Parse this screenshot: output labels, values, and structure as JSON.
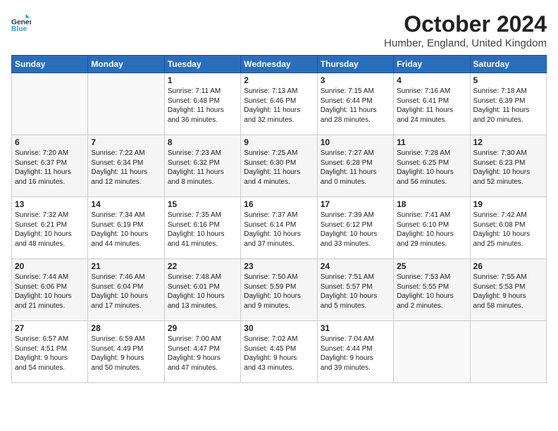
{
  "header": {
    "logo_line1": "General",
    "logo_line2": "Blue",
    "month": "October 2024",
    "location": "Humber, England, United Kingdom"
  },
  "days_of_week": [
    "Sunday",
    "Monday",
    "Tuesday",
    "Wednesday",
    "Thursday",
    "Friday",
    "Saturday"
  ],
  "weeks": [
    [
      {
        "day": "",
        "content": ""
      },
      {
        "day": "",
        "content": ""
      },
      {
        "day": "1",
        "content": "Sunrise: 7:11 AM\nSunset: 6:48 PM\nDaylight: 11 hours\nand 36 minutes."
      },
      {
        "day": "2",
        "content": "Sunrise: 7:13 AM\nSunset: 6:46 PM\nDaylight: 11 hours\nand 32 minutes."
      },
      {
        "day": "3",
        "content": "Sunrise: 7:15 AM\nSunset: 6:44 PM\nDaylight: 11 hours\nand 28 minutes."
      },
      {
        "day": "4",
        "content": "Sunrise: 7:16 AM\nSunset: 6:41 PM\nDaylight: 11 hours\nand 24 minutes."
      },
      {
        "day": "5",
        "content": "Sunrise: 7:18 AM\nSunset: 6:39 PM\nDaylight: 11 hours\nand 20 minutes."
      }
    ],
    [
      {
        "day": "6",
        "content": "Sunrise: 7:20 AM\nSunset: 6:37 PM\nDaylight: 11 hours\nand 16 minutes."
      },
      {
        "day": "7",
        "content": "Sunrise: 7:22 AM\nSunset: 6:34 PM\nDaylight: 11 hours\nand 12 minutes."
      },
      {
        "day": "8",
        "content": "Sunrise: 7:23 AM\nSunset: 6:32 PM\nDaylight: 11 hours\nand 8 minutes."
      },
      {
        "day": "9",
        "content": "Sunrise: 7:25 AM\nSunset: 6:30 PM\nDaylight: 11 hours\nand 4 minutes."
      },
      {
        "day": "10",
        "content": "Sunrise: 7:27 AM\nSunset: 6:28 PM\nDaylight: 11 hours\nand 0 minutes."
      },
      {
        "day": "11",
        "content": "Sunrise: 7:28 AM\nSunset: 6:25 PM\nDaylight: 10 hours\nand 56 minutes."
      },
      {
        "day": "12",
        "content": "Sunrise: 7:30 AM\nSunset: 6:23 PM\nDaylight: 10 hours\nand 52 minutes."
      }
    ],
    [
      {
        "day": "13",
        "content": "Sunrise: 7:32 AM\nSunset: 6:21 PM\nDaylight: 10 hours\nand 48 minutes."
      },
      {
        "day": "14",
        "content": "Sunrise: 7:34 AM\nSunset: 6:19 PM\nDaylight: 10 hours\nand 44 minutes."
      },
      {
        "day": "15",
        "content": "Sunrise: 7:35 AM\nSunset: 6:16 PM\nDaylight: 10 hours\nand 41 minutes."
      },
      {
        "day": "16",
        "content": "Sunrise: 7:37 AM\nSunset: 6:14 PM\nDaylight: 10 hours\nand 37 minutes."
      },
      {
        "day": "17",
        "content": "Sunrise: 7:39 AM\nSunset: 6:12 PM\nDaylight: 10 hours\nand 33 minutes."
      },
      {
        "day": "18",
        "content": "Sunrise: 7:41 AM\nSunset: 6:10 PM\nDaylight: 10 hours\nand 29 minutes."
      },
      {
        "day": "19",
        "content": "Sunrise: 7:42 AM\nSunset: 6:08 PM\nDaylight: 10 hours\nand 25 minutes."
      }
    ],
    [
      {
        "day": "20",
        "content": "Sunrise: 7:44 AM\nSunset: 6:06 PM\nDaylight: 10 hours\nand 21 minutes."
      },
      {
        "day": "21",
        "content": "Sunrise: 7:46 AM\nSunset: 6:04 PM\nDaylight: 10 hours\nand 17 minutes."
      },
      {
        "day": "22",
        "content": "Sunrise: 7:48 AM\nSunset: 6:01 PM\nDaylight: 10 hours\nand 13 minutes."
      },
      {
        "day": "23",
        "content": "Sunrise: 7:50 AM\nSunset: 5:59 PM\nDaylight: 10 hours\nand 9 minutes."
      },
      {
        "day": "24",
        "content": "Sunrise: 7:51 AM\nSunset: 5:57 PM\nDaylight: 10 hours\nand 5 minutes."
      },
      {
        "day": "25",
        "content": "Sunrise: 7:53 AM\nSunset: 5:55 PM\nDaylight: 10 hours\nand 2 minutes."
      },
      {
        "day": "26",
        "content": "Sunrise: 7:55 AM\nSunset: 5:53 PM\nDaylight: 9 hours\nand 58 minutes."
      }
    ],
    [
      {
        "day": "27",
        "content": "Sunrise: 6:57 AM\nSunset: 4:51 PM\nDaylight: 9 hours\nand 54 minutes."
      },
      {
        "day": "28",
        "content": "Sunrise: 6:59 AM\nSunset: 4:49 PM\nDaylight: 9 hours\nand 50 minutes."
      },
      {
        "day": "29",
        "content": "Sunrise: 7:00 AM\nSunset: 4:47 PM\nDaylight: 9 hours\nand 47 minutes."
      },
      {
        "day": "30",
        "content": "Sunrise: 7:02 AM\nSunset: 4:45 PM\nDaylight: 9 hours\nand 43 minutes."
      },
      {
        "day": "31",
        "content": "Sunrise: 7:04 AM\nSunset: 4:44 PM\nDaylight: 9 hours\nand 39 minutes."
      },
      {
        "day": "",
        "content": ""
      },
      {
        "day": "",
        "content": ""
      }
    ]
  ]
}
